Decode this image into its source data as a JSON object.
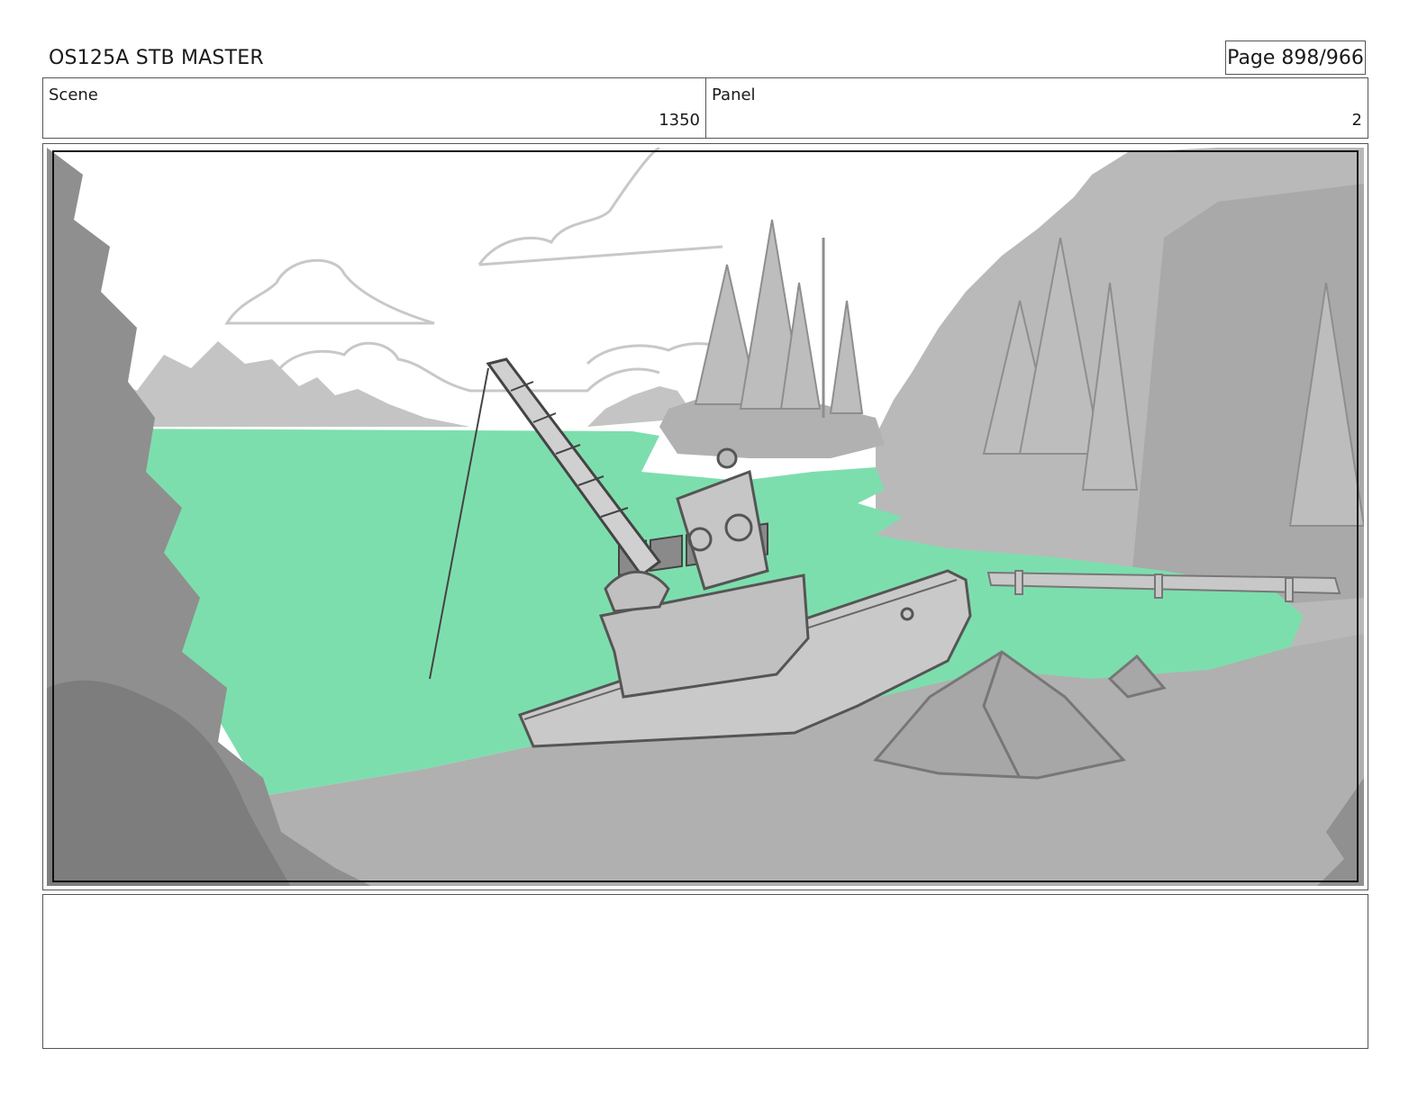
{
  "header": {
    "title": "OS125A STB MASTER",
    "page": "Page 898/966"
  },
  "info": {
    "scene_label": "Scene",
    "scene_value": "1350",
    "panel_label": "Panel",
    "panel_value": "2"
  },
  "colors": {
    "water": "#7ddead",
    "sketch_gray": "#b4b4b4",
    "dark_gray": "#8c8c8c",
    "line": "#444444"
  },
  "notes": {
    "text": ""
  }
}
